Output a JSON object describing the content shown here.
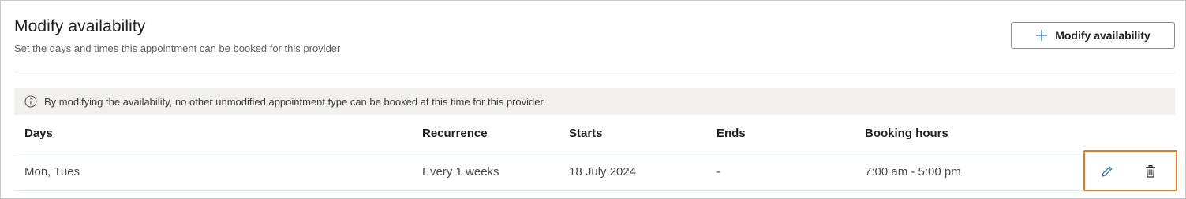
{
  "header": {
    "title": "Modify availability",
    "subtitle": "Set the days and times this appointment can be booked for this provider",
    "add_button_label": "Modify availability",
    "add_button_icon": "plus-icon"
  },
  "info": {
    "icon": "info-icon",
    "message": "By modifying the availability, no other unmodified appointment type can be booked at this time for this provider."
  },
  "table": {
    "columns": [
      "Days",
      "Recurrence",
      "Starts",
      "Ends",
      "Booking hours"
    ],
    "rows": [
      {
        "days": "Mon, Tues",
        "recurrence": "Every 1 weeks",
        "starts": "18 July 2024",
        "ends": "-",
        "booking_hours": "7:00 am - 5:00 pm"
      }
    ],
    "row_actions": [
      "edit-icon",
      "trash-icon"
    ]
  },
  "colors": {
    "highlight": "#e87722",
    "edit_icon": "#3b7bb8",
    "info_bar_bg": "#f1f0ee"
  }
}
